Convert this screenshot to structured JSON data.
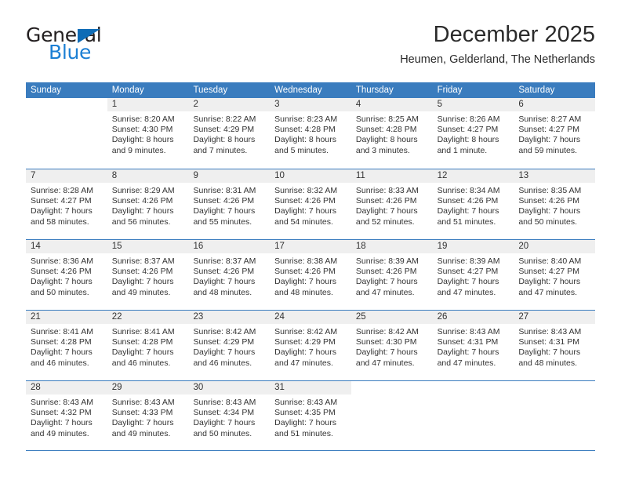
{
  "brand": {
    "word_top": "General",
    "word_bottom": "Blue",
    "triangle_color": "#0f6cb6",
    "blue_text_color": "#1b7fd4"
  },
  "header": {
    "title": "December 2025",
    "subtitle": "Heumen, Gelderland, The Netherlands",
    "header_bg_color": "#3a7cbe",
    "daynum_bg_color": "#efefef"
  },
  "calendar": {
    "weekday_headers": [
      "Sunday",
      "Monday",
      "Tuesday",
      "Wednesday",
      "Thursday",
      "Friday",
      "Saturday"
    ],
    "weeks": [
      [
        {
          "day": "",
          "lines": []
        },
        {
          "day": "1",
          "lines": [
            "Sunrise: 8:20 AM",
            "Sunset: 4:30 PM",
            "Daylight: 8 hours",
            "and 9 minutes."
          ]
        },
        {
          "day": "2",
          "lines": [
            "Sunrise: 8:22 AM",
            "Sunset: 4:29 PM",
            "Daylight: 8 hours",
            "and 7 minutes."
          ]
        },
        {
          "day": "3",
          "lines": [
            "Sunrise: 8:23 AM",
            "Sunset: 4:28 PM",
            "Daylight: 8 hours",
            "and 5 minutes."
          ]
        },
        {
          "day": "4",
          "lines": [
            "Sunrise: 8:25 AM",
            "Sunset: 4:28 PM",
            "Daylight: 8 hours",
            "and 3 minutes."
          ]
        },
        {
          "day": "5",
          "lines": [
            "Sunrise: 8:26 AM",
            "Sunset: 4:27 PM",
            "Daylight: 8 hours",
            "and 1 minute."
          ]
        },
        {
          "day": "6",
          "lines": [
            "Sunrise: 8:27 AM",
            "Sunset: 4:27 PM",
            "Daylight: 7 hours",
            "and 59 minutes."
          ]
        }
      ],
      [
        {
          "day": "7",
          "lines": [
            "Sunrise: 8:28 AM",
            "Sunset: 4:27 PM",
            "Daylight: 7 hours",
            "and 58 minutes."
          ]
        },
        {
          "day": "8",
          "lines": [
            "Sunrise: 8:29 AM",
            "Sunset: 4:26 PM",
            "Daylight: 7 hours",
            "and 56 minutes."
          ]
        },
        {
          "day": "9",
          "lines": [
            "Sunrise: 8:31 AM",
            "Sunset: 4:26 PM",
            "Daylight: 7 hours",
            "and 55 minutes."
          ]
        },
        {
          "day": "10",
          "lines": [
            "Sunrise: 8:32 AM",
            "Sunset: 4:26 PM",
            "Daylight: 7 hours",
            "and 54 minutes."
          ]
        },
        {
          "day": "11",
          "lines": [
            "Sunrise: 8:33 AM",
            "Sunset: 4:26 PM",
            "Daylight: 7 hours",
            "and 52 minutes."
          ]
        },
        {
          "day": "12",
          "lines": [
            "Sunrise: 8:34 AM",
            "Sunset: 4:26 PM",
            "Daylight: 7 hours",
            "and 51 minutes."
          ]
        },
        {
          "day": "13",
          "lines": [
            "Sunrise: 8:35 AM",
            "Sunset: 4:26 PM",
            "Daylight: 7 hours",
            "and 50 minutes."
          ]
        }
      ],
      [
        {
          "day": "14",
          "lines": [
            "Sunrise: 8:36 AM",
            "Sunset: 4:26 PM",
            "Daylight: 7 hours",
            "and 50 minutes."
          ]
        },
        {
          "day": "15",
          "lines": [
            "Sunrise: 8:37 AM",
            "Sunset: 4:26 PM",
            "Daylight: 7 hours",
            "and 49 minutes."
          ]
        },
        {
          "day": "16",
          "lines": [
            "Sunrise: 8:37 AM",
            "Sunset: 4:26 PM",
            "Daylight: 7 hours",
            "and 48 minutes."
          ]
        },
        {
          "day": "17",
          "lines": [
            "Sunrise: 8:38 AM",
            "Sunset: 4:26 PM",
            "Daylight: 7 hours",
            "and 48 minutes."
          ]
        },
        {
          "day": "18",
          "lines": [
            "Sunrise: 8:39 AM",
            "Sunset: 4:26 PM",
            "Daylight: 7 hours",
            "and 47 minutes."
          ]
        },
        {
          "day": "19",
          "lines": [
            "Sunrise: 8:39 AM",
            "Sunset: 4:27 PM",
            "Daylight: 7 hours",
            "and 47 minutes."
          ]
        },
        {
          "day": "20",
          "lines": [
            "Sunrise: 8:40 AM",
            "Sunset: 4:27 PM",
            "Daylight: 7 hours",
            "and 47 minutes."
          ]
        }
      ],
      [
        {
          "day": "21",
          "lines": [
            "Sunrise: 8:41 AM",
            "Sunset: 4:28 PM",
            "Daylight: 7 hours",
            "and 46 minutes."
          ]
        },
        {
          "day": "22",
          "lines": [
            "Sunrise: 8:41 AM",
            "Sunset: 4:28 PM",
            "Daylight: 7 hours",
            "and 46 minutes."
          ]
        },
        {
          "day": "23",
          "lines": [
            "Sunrise: 8:42 AM",
            "Sunset: 4:29 PM",
            "Daylight: 7 hours",
            "and 46 minutes."
          ]
        },
        {
          "day": "24",
          "lines": [
            "Sunrise: 8:42 AM",
            "Sunset: 4:29 PM",
            "Daylight: 7 hours",
            "and 47 minutes."
          ]
        },
        {
          "day": "25",
          "lines": [
            "Sunrise: 8:42 AM",
            "Sunset: 4:30 PM",
            "Daylight: 7 hours",
            "and 47 minutes."
          ]
        },
        {
          "day": "26",
          "lines": [
            "Sunrise: 8:43 AM",
            "Sunset: 4:31 PM",
            "Daylight: 7 hours",
            "and 47 minutes."
          ]
        },
        {
          "day": "27",
          "lines": [
            "Sunrise: 8:43 AM",
            "Sunset: 4:31 PM",
            "Daylight: 7 hours",
            "and 48 minutes."
          ]
        }
      ],
      [
        {
          "day": "28",
          "lines": [
            "Sunrise: 8:43 AM",
            "Sunset: 4:32 PM",
            "Daylight: 7 hours",
            "and 49 minutes."
          ]
        },
        {
          "day": "29",
          "lines": [
            "Sunrise: 8:43 AM",
            "Sunset: 4:33 PM",
            "Daylight: 7 hours",
            "and 49 minutes."
          ]
        },
        {
          "day": "30",
          "lines": [
            "Sunrise: 8:43 AM",
            "Sunset: 4:34 PM",
            "Daylight: 7 hours",
            "and 50 minutes."
          ]
        },
        {
          "day": "31",
          "lines": [
            "Sunrise: 8:43 AM",
            "Sunset: 4:35 PM",
            "Daylight: 7 hours",
            "and 51 minutes."
          ]
        },
        {
          "day": "",
          "lines": []
        },
        {
          "day": "",
          "lines": []
        },
        {
          "day": "",
          "lines": []
        }
      ]
    ]
  }
}
